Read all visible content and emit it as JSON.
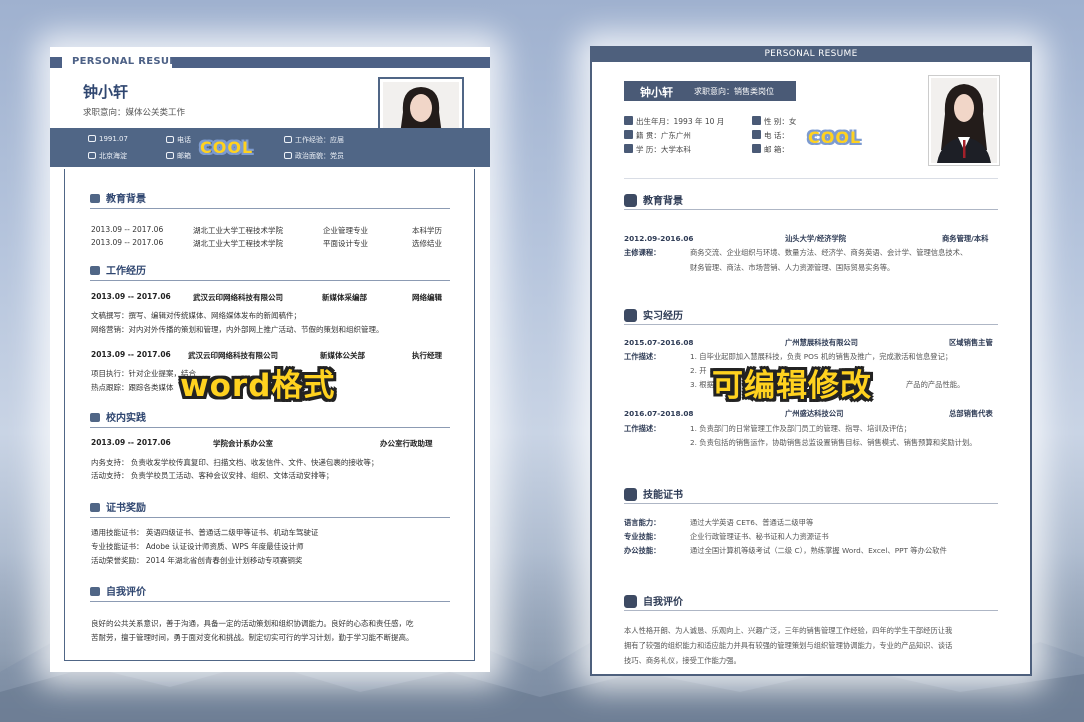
{
  "left": {
    "banner": "PERSONAL RESUME",
    "name": "钟小轩",
    "job": "求职意向：媒体公关类工作",
    "info": {
      "birth": "1991.07",
      "location": "北京海淀",
      "phone": "电话",
      "email": "邮箱",
      "experience": "工作经验：应届",
      "politics": "政治面貌：党员"
    },
    "sections": {
      "education": "教育背景",
      "work": "工作经历",
      "campus": "校内实践",
      "certs": "证书奖励",
      "self": "自我评价"
    },
    "education_rows": [
      {
        "date": "2013.09 -- 2017.06",
        "school": "湖北工业大学工程技术学院",
        "major": "企业管理专业",
        "degree": "本科学历"
      },
      {
        "date": "2013.09 -- 2017.06",
        "school": "湖北工业大学工程技术学院",
        "major": "平面设计专业",
        "degree": "选修结业"
      }
    ],
    "work_rows": [
      {
        "date": "2013.09 -- 2017.06",
        "company": "武汉云印网络科技有限公司",
        "dept": "新媒体采编部",
        "role": "网络编辑",
        "l1": "文稿撰写：撰写、编辑对传统媒体、网络媒体发布的新闻稿件；",
        "l2": "网络营销：对内对外传播的策划和管理，内外部网上推广活动、节假的策划和组织管理。"
      },
      {
        "date": "2013.09 -- 2017.06",
        "company": "武汉云印网络科技有限公司",
        "dept": "新媒体公关部",
        "role": "执行经理",
        "l1": "项目执行：针对企业提案，结合",
        "l2": "热点跟踪：跟踪各类媒体"
      }
    ],
    "campus_row": {
      "date": "2013.09 -- 2017.06",
      "org": "学院会计系办公室",
      "role": "办公室行政助理",
      "l1": "内务支持：   负责收发学校传真复印、扫描文档、收发信件、文件、快递包裹的接收等；",
      "l2": "活动支持：   负责学校员工活动、客种会议安排、组织、文体活动安排等；"
    },
    "cert_rows": [
      "通用技能证书：    英语四级证书、普通话二级甲等证书、机动车驾驶证",
      "专业技能证书：    Adobe 认证设计师资质、WPS 年度最佳设计师",
      "活动荣誉奖励：    2014 年湖北省创青春创业计划移动专项赛铜奖"
    ],
    "self_text_1": "良好的公共关系意识，善于沟通，具备一定的活动策划和组织协调能力。良好的心态和责任感，吃",
    "self_text_2": "苦耐劳，擅于管理时间，勇于面对变化和挑战。制定切实可行的学习计划，勤于学习能不断提高。",
    "sticker": "COOL"
  },
  "right": {
    "banner": "PERSONAL RESUME",
    "name": "钟小轩",
    "job": "求职意向：销售类岗位",
    "info": {
      "birth": "出生年月：1993 年 10 月",
      "origin": "籍      贯：广东广州",
      "edu": "学      历：大学本科",
      "gender": "性      别：女",
      "phone": "电      话：",
      "email": "邮      箱："
    },
    "sections": {
      "education": "教育背景",
      "work": "实习经历",
      "skills": "技能证书",
      "self": "自我评价"
    },
    "edu": {
      "date": "2012.09-2016.06",
      "school": "汕头大学/经济学院",
      "major": "商务管理/本科",
      "label": "主修课程：",
      "l1": "商务交流、企业组织与环境、数量方法、经济学、商务英语、会计学、管理信息技术、",
      "l2": "财务管理、商法、市场营销、人力资源管理、国际贸易实务等。"
    },
    "work": [
      {
        "date": "2015.07-2016.08",
        "company": "广州慧展科技有限公司",
        "role": "区域销售主管",
        "label": "工作描述：",
        "l1": "1. 自毕业起即加入慧展科技，负责 POS 机的销售及推广，完成激活和信息登记；",
        "l2": "2. 开",
        "l3": "3. 根据",
        "l3b": "产品的产品性能。"
      },
      {
        "date": "2016.07-2018.08",
        "company": "广州盛达科技公司",
        "role": "总部销售代表",
        "label": "工作描述：",
        "l1": "1. 负责部门的日常管理工作及部门员工的管理、指导、培训及评估；",
        "l2": "2. 负责包括的销售运作，协助销售总监设置销售目标、销售模式、销售预算和奖励计划。"
      }
    ],
    "skills": [
      {
        "label": "语言能力：",
        "text": "通过大学英语 CET6、普通话二级甲等"
      },
      {
        "label": "专业技能：",
        "text": "企业行政管理证书、秘书证和人力资源证书"
      },
      {
        "label": "办公技能：",
        "text": "通过全国计算机等级考试（二级 C），熟练掌握 Word、Excel、PPT 等办公软件"
      }
    ],
    "self_1": "本人性格开朗、为人诚恳、乐观向上、兴趣广泛，三年的销售管理工作经验，四年的学生干部经历让我",
    "self_2": "拥有了较强的组织能力和适应能力并具有较强的管理策划与组织管理协调能力，专业的产品知识、谈话",
    "self_3": "技巧、商务礼仪，接受工作能力强。",
    "sticker": "COOL"
  },
  "overlays": {
    "left_text": "word格式",
    "right_text": "可编辑修改"
  }
}
